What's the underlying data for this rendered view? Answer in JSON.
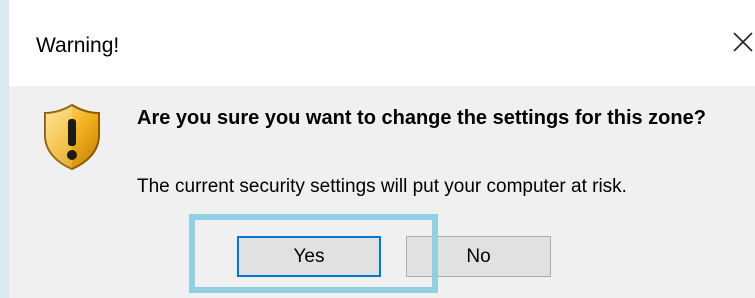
{
  "window": {
    "title": "Warning!",
    "close_symbol": "✕"
  },
  "dialog": {
    "icon": "shield-warning-icon",
    "heading": "Are you sure you want to change the settings for this zone?",
    "message": "The current security settings will put your computer at risk."
  },
  "buttons": {
    "yes_label": "Yes",
    "no_label": "No",
    "default": "Yes"
  },
  "colors": {
    "highlight": "#8fd0e4",
    "focus_border": "#0078d7",
    "body_background": "#f0f0f0",
    "button_background": "#e1e1e1",
    "shield_gold": "#f2b41f",
    "shield_dark": "#8a5a00"
  }
}
